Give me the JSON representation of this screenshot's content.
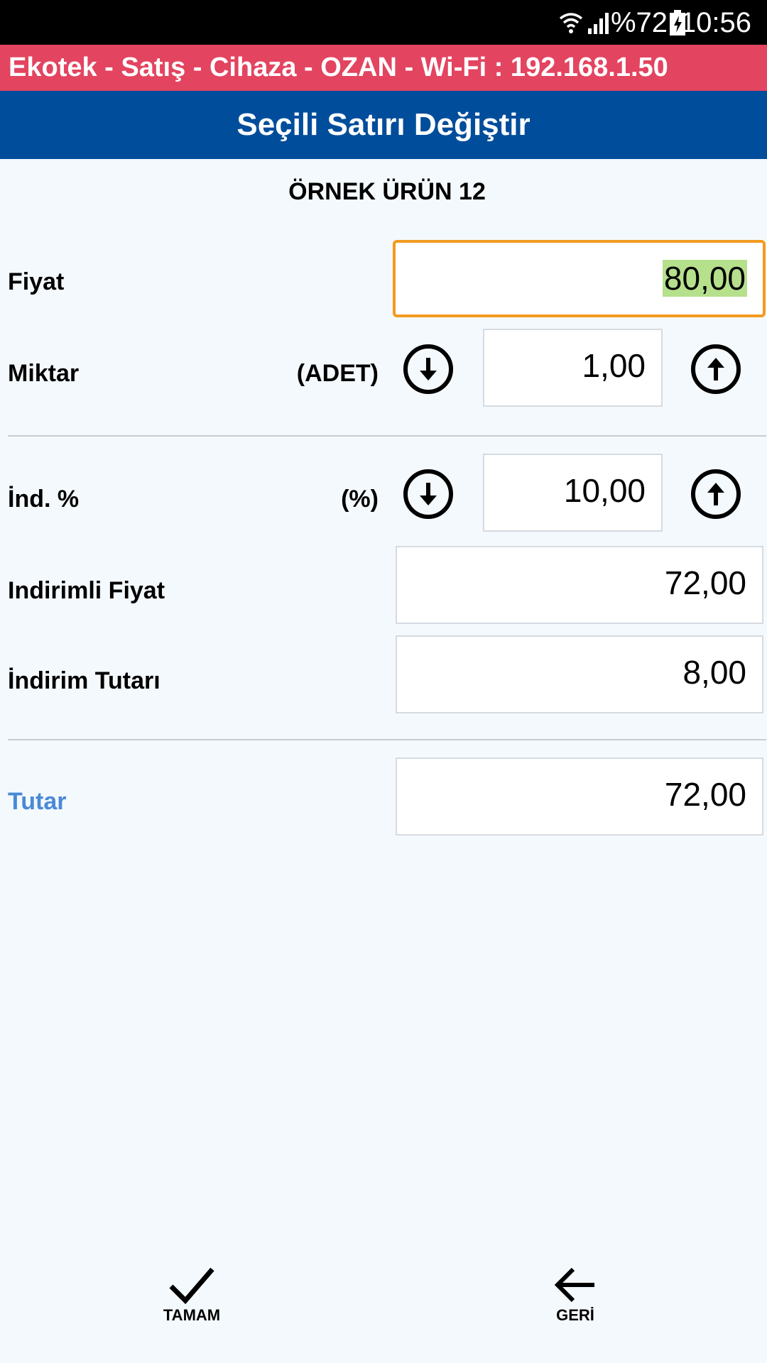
{
  "status_bar": {
    "battery_text": "%72",
    "time": "10:56"
  },
  "app_bar": {
    "title": "Ekotek - Satış - Cihaza - OZAN - Wi-Fi : 192.168.1.50"
  },
  "screen": {
    "title": "Seçili Satırı Değiştir",
    "product_name": "ÖRNEK ÜRÜN 12"
  },
  "form": {
    "fiyat": {
      "label": "Fiyat",
      "value": "80,00"
    },
    "miktar": {
      "label": "Miktar",
      "unit": "(ADET)",
      "value": "1,00"
    },
    "indirim_yuzde": {
      "label": "İnd. %",
      "unit": "(%)",
      "value": "10,00"
    },
    "indirimli_fiyat": {
      "label": "Indirimli Fiyat",
      "value": "72,00"
    },
    "indirim_tutari": {
      "label": "İndirim Tutarı",
      "value": "8,00"
    },
    "tutar": {
      "label": "Tutar",
      "value": "72,00"
    }
  },
  "bottom_bar": {
    "ok_label": "TAMAM",
    "back_label": "GERİ"
  },
  "colors": {
    "app_bar": "#e34460",
    "title_bar": "#004d9b",
    "focus_border": "#f39a1e",
    "selection": "#b6e08c",
    "tutar_label": "#4a8ad6"
  }
}
